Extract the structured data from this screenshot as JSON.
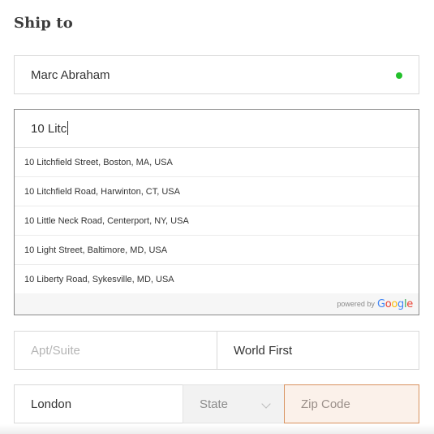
{
  "form": {
    "heading": "Ship to",
    "name_field": {
      "value": "Marc Abraham",
      "status_color": "#22c02b"
    },
    "address_field": {
      "value": "10 Litc",
      "suggestions": [
        "10 Litchfield Street, Boston, MA, USA",
        "10 Litchfield Road, Harwinton, CT, USA",
        "10 Little Neck Road, Centerport, NY, USA",
        "10 Light Street, Baltimore, MD, USA",
        "10 Liberty Road, Sykesville, MD, USA"
      ],
      "powered_by": "powered by",
      "google_logo": "Google"
    },
    "apt_field": {
      "placeholder": "Apt/Suite",
      "value": ""
    },
    "company_field": {
      "value": "World First"
    },
    "city_field": {
      "value": "London"
    },
    "state_field": {
      "placeholder": "State",
      "icon": "chevron-down-icon"
    },
    "zip_field": {
      "placeholder": "Zip Code",
      "value": "",
      "focus_color": "#d8925f"
    }
  }
}
